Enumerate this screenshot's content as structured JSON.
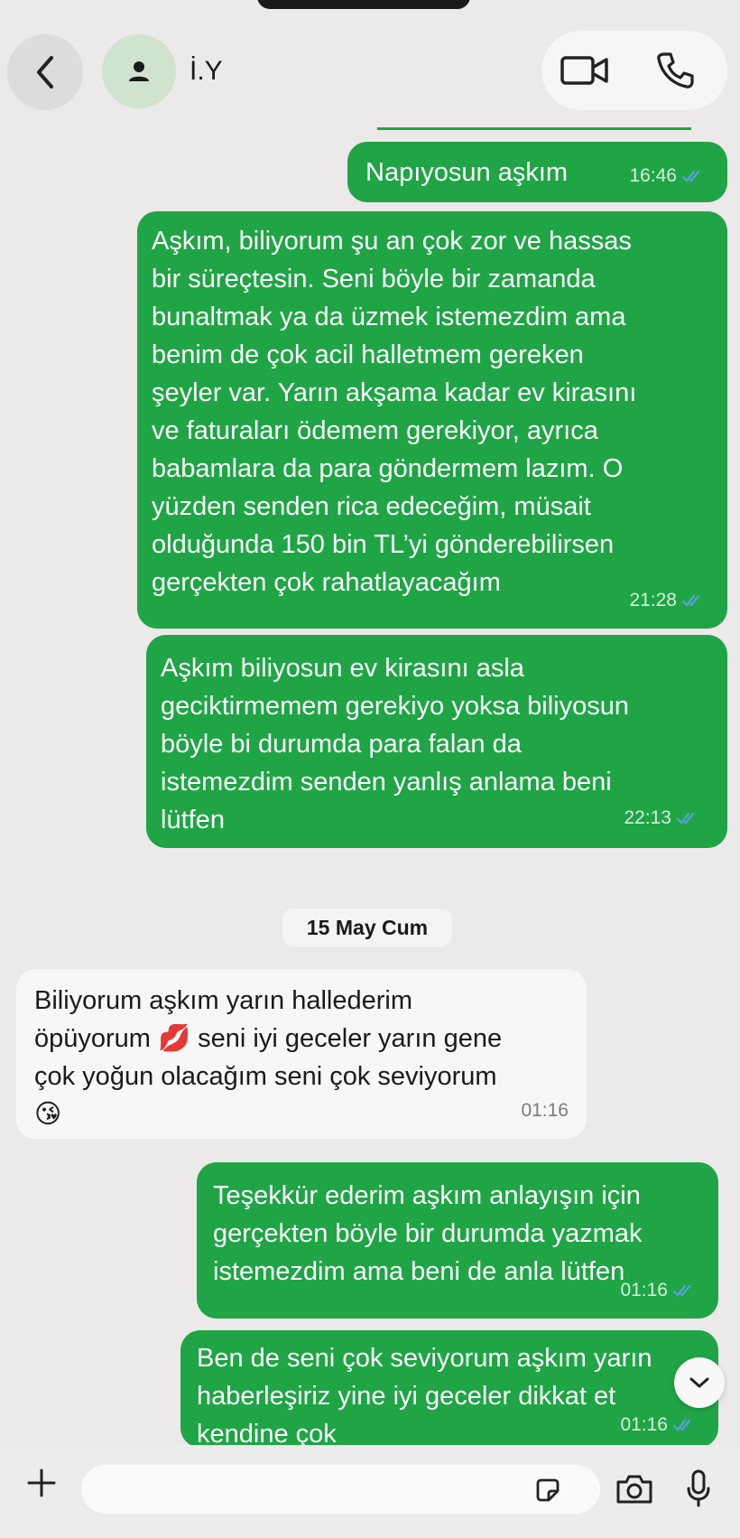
{
  "header": {
    "contact_name": "İ.Y",
    "back_icon": "chevron-left-icon",
    "avatar_icon": "person-icon",
    "video_icon": "video-camera-icon",
    "phone_icon": "phone-icon"
  },
  "messages": [
    {
      "direction": "out",
      "text": "Napıyosun aşkım",
      "time": "16:46",
      "status": "read"
    },
    {
      "direction": "out",
      "text": "Aşkım, biliyorum şu an çok zor ve hassas\nbir süreçtesin. Seni böyle bir zamanda\nbunaltmak ya da üzmek istemezdim ama\nbenim de çok acil halletmem gereken\nşeyler var. Yarın akşama kadar ev kirasını\nve faturaları ödemem gerekiyor, ayrıca\nbabamlara da para göndermem lazım. O\nyüzden senden rica edeceğim, müsait\nolduğunda 150 bin TL’yi gönderebilirsen\ngerçekten çok rahatlayacağım",
      "time": "21:28",
      "status": "read"
    },
    {
      "direction": "out",
      "text": "Aşkım biliyosun ev kirasını asla\ngeciktirmemem gerekiyo yoksa biliyosun\nböyle bi durumda para falan da\nistemezdim senden yanlış anlama beni\nlütfen",
      "time": "22:13",
      "status": "read"
    },
    {
      "direction": "in",
      "text": "Biliyorum aşkım yarın hallederim\nöpüyorum 💋 seni iyi geceler yarın gene\nçok yoğun olacağım seni çok seviyorum\n😘",
      "time": "01:16"
    },
    {
      "direction": "out",
      "text": "Teşekkür ederim aşkım anlayışın için\ngerçekten böyle bir durumda yazmak\nistemezdim ama beni de anla lütfen",
      "time": "01:16",
      "status": "read"
    },
    {
      "direction": "out",
      "text": "Ben de seni çok seviyorum aşkım yarın\nhaberleşiriz yine iyi geceler dikkat et\nkendine çok",
      "time": "01:16",
      "status": "read"
    }
  ],
  "date_separator": "15 May Cum",
  "composer": {
    "placeholder": "",
    "plus_icon": "plus-icon",
    "sticker_icon": "sticker-icon",
    "camera_icon": "camera-icon",
    "mic_icon": "microphone-icon"
  },
  "scroll_icon": "chevron-down-icon",
  "colors": {
    "outgoing_bubble": "#1fa545",
    "incoming_bubble": "#f7f7f7",
    "background": "#ece9ea",
    "read_ticks": "#5aa0e8"
  }
}
